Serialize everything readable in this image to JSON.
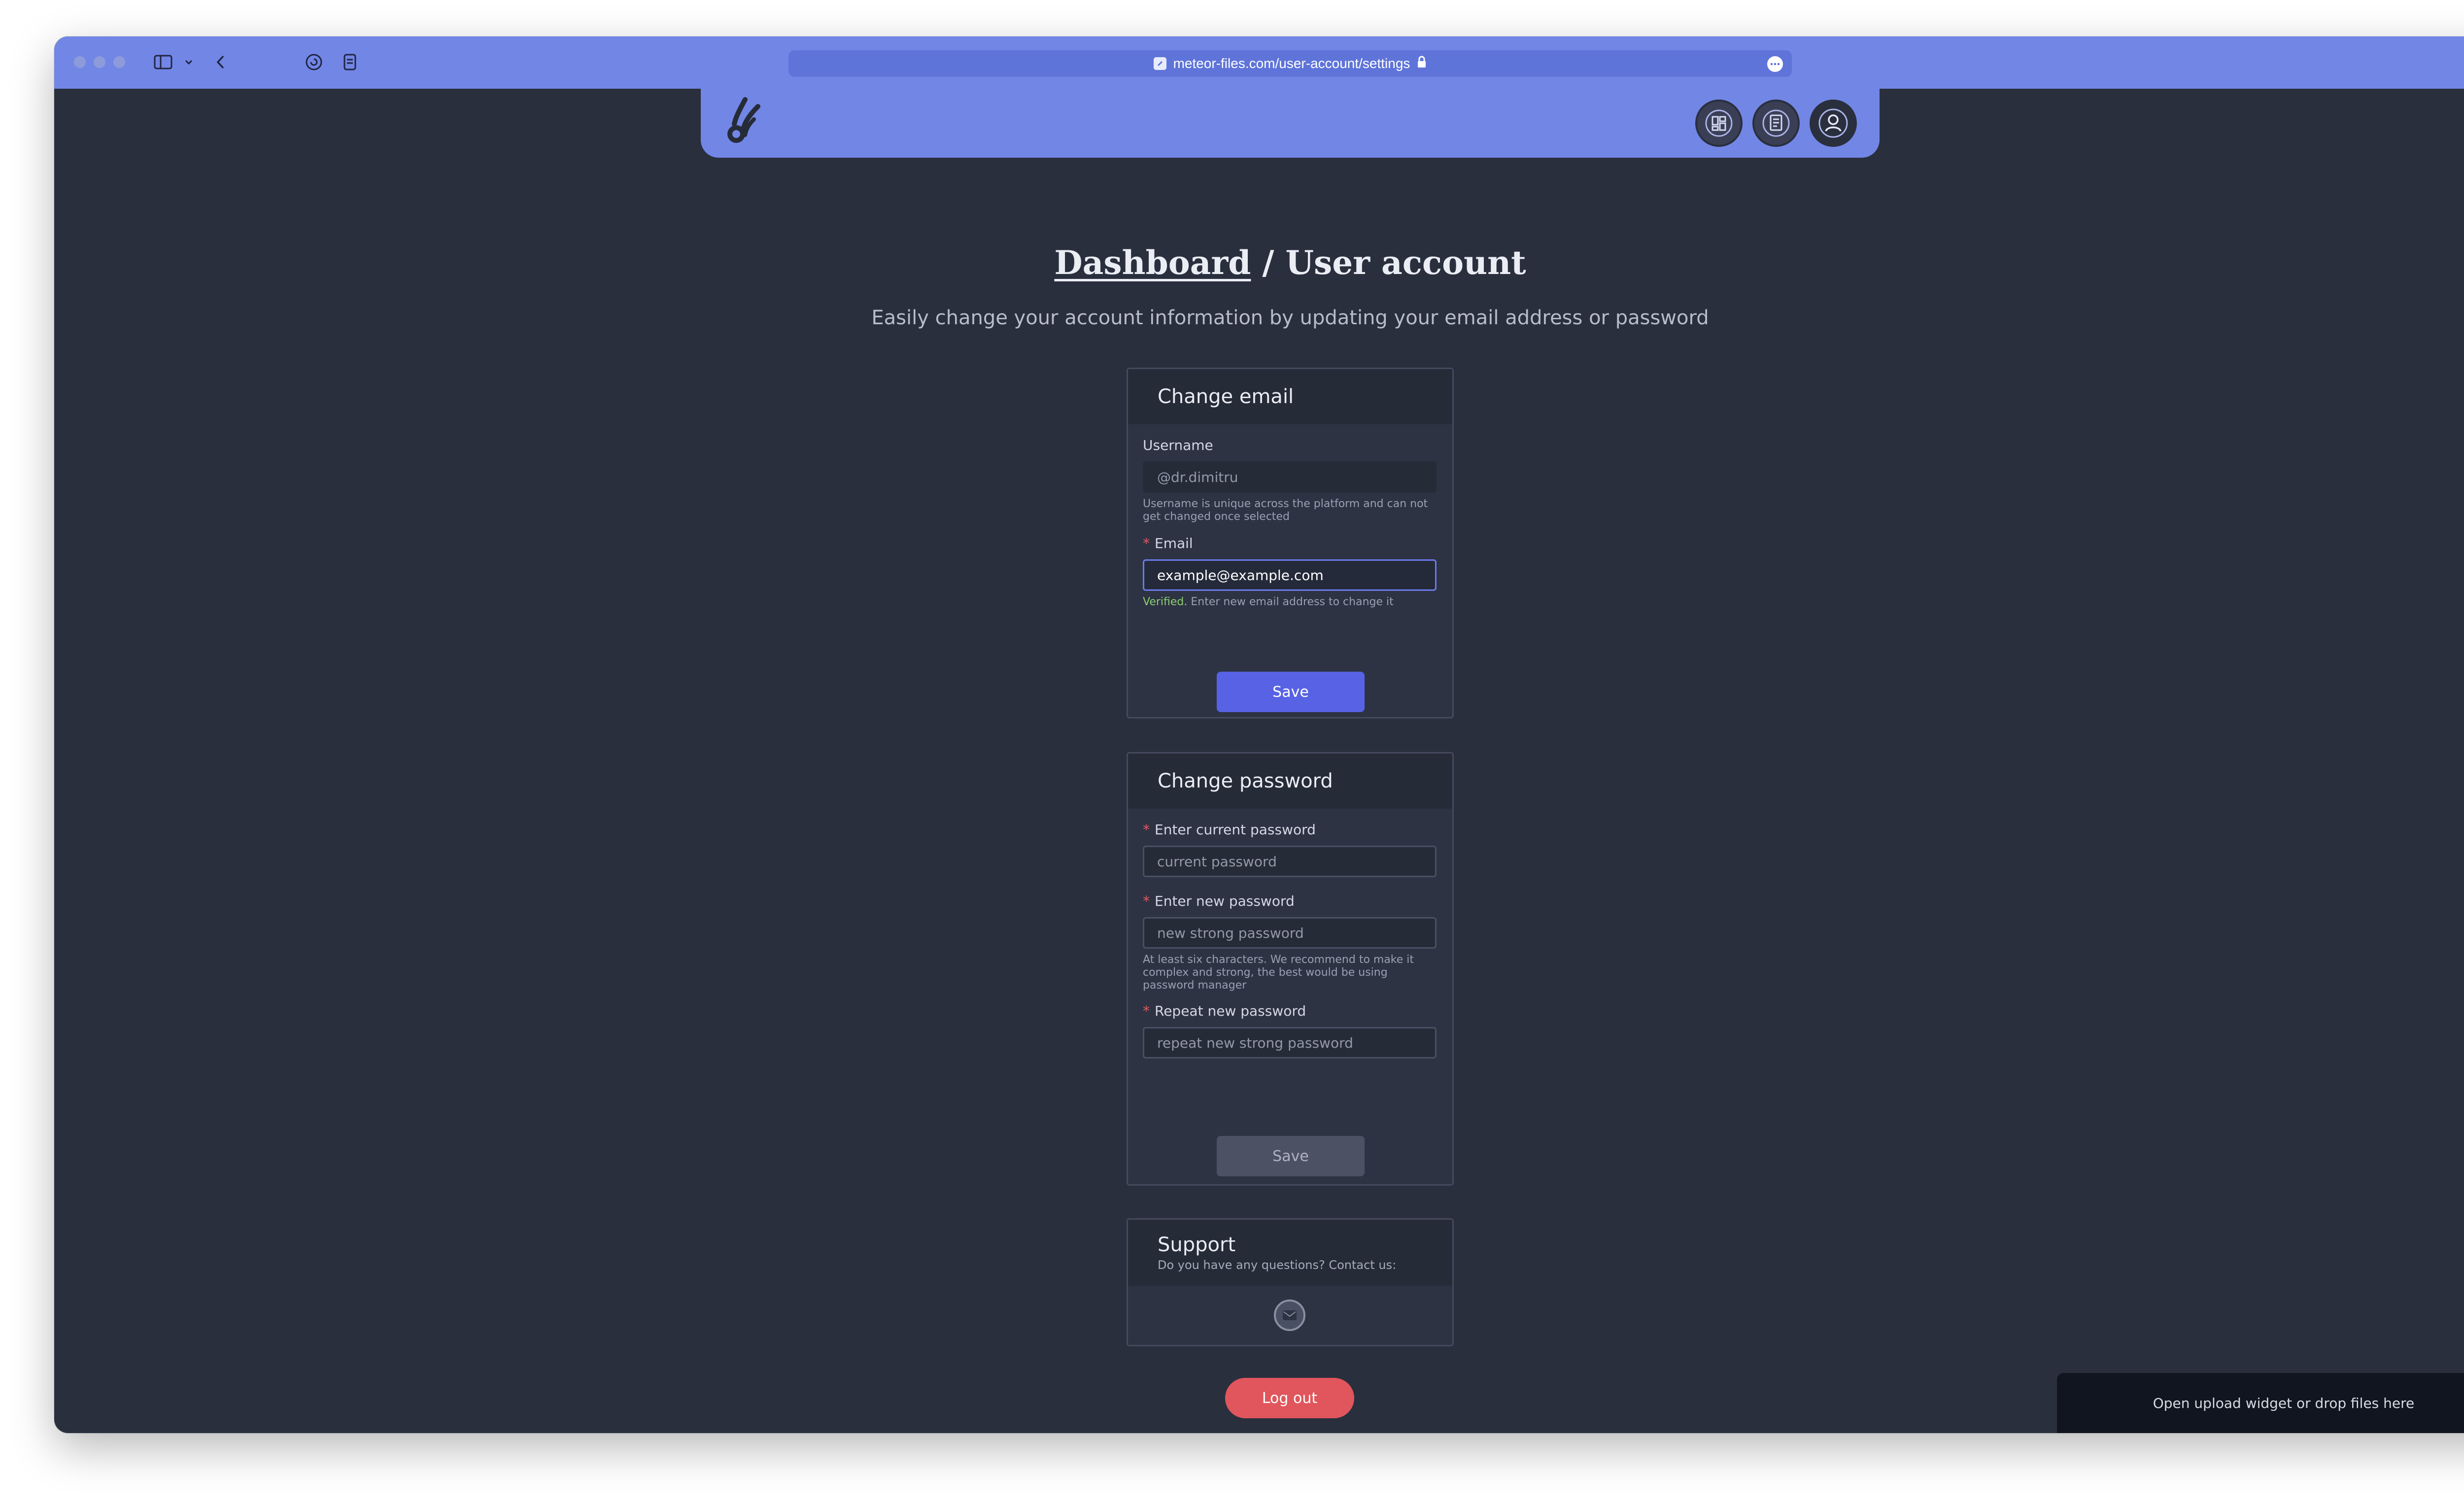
{
  "browser": {
    "url": "meteor-files.com/user-account/settings"
  },
  "icons": {
    "logo": "meteor-logo-icon",
    "dashboard": "dashboard-grid-icon",
    "docs": "document-icon",
    "account": "user-icon",
    "support": "mail-icon"
  },
  "page": {
    "breadcrumb_link": "Dashboard",
    "breadcrumb_sep": " / ",
    "breadcrumb_current": "User account",
    "subtitle": "Easily change your account information by updating your email address or password"
  },
  "change_email": {
    "title": "Change email",
    "username_label": "Username",
    "username_placeholder": "@dr.dimitru",
    "username_hint": "Username is unique across the platform and can not get changed once selected",
    "email_label": "Email",
    "email_value": "example@example.com",
    "email_status": "Verified.",
    "email_hint": " Enter new email address to change it",
    "save_label": "Save"
  },
  "change_password": {
    "title": "Change password",
    "current_label": "Enter current password",
    "current_placeholder": "current password",
    "new_label": "Enter new password",
    "new_placeholder": "new strong password",
    "new_hint": "At least six characters. We recommend to make it complex and strong, the best would be using password manager",
    "repeat_label": "Repeat new password",
    "repeat_placeholder": "repeat new strong password",
    "save_label": "Save"
  },
  "support": {
    "title": "Support",
    "description": "Do you have any questions? Contact us:"
  },
  "logout_label": "Log out",
  "upload_widget_label": "Open upload widget or drop files here",
  "colors": {
    "accent": "#7286e6",
    "primary_button": "#5862e4",
    "danger": "#e0565c",
    "verified": "#8bcf6e",
    "background": "#2a2f3e"
  }
}
